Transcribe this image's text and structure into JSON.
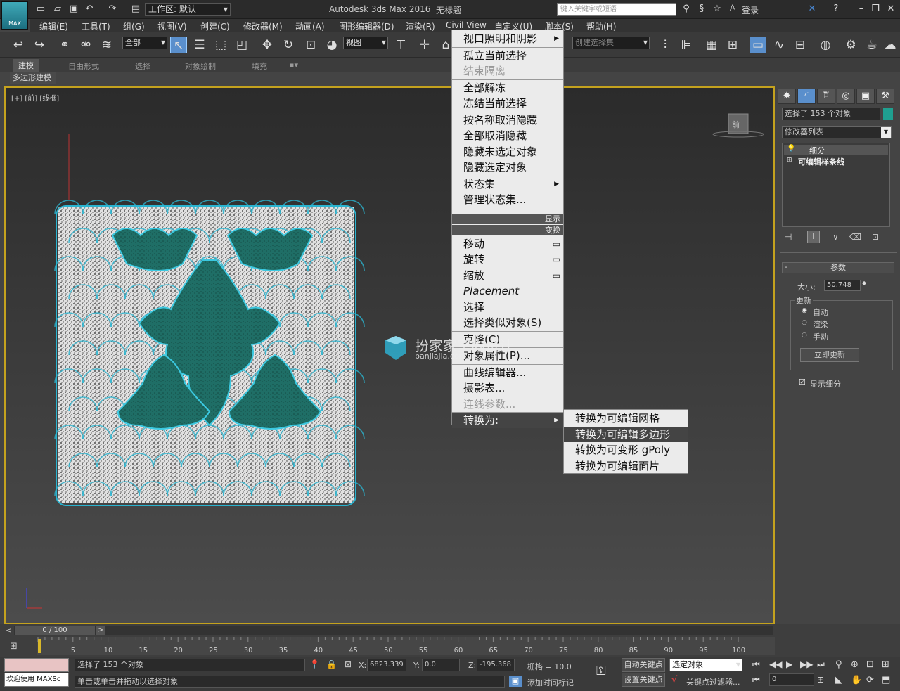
{
  "title": {
    "app": "Autodesk 3ds Max 2016",
    "doc": "无标题",
    "workspace": "工作区: 默认",
    "search_placeholder": "键入关键字或短语",
    "login": "登录",
    "max_logo": "MAX"
  },
  "menu": [
    "编辑(E)",
    "工具(T)",
    "组(G)",
    "视图(V)",
    "创建(C)",
    "修改器(M)",
    "动画(A)",
    "图形编辑器(D)",
    "渲染(R)",
    "Civil View",
    "自定义(U)",
    "脚本(S)",
    "帮助(H)"
  ],
  "toolbar": {
    "filter": "全部",
    "refcoord": "视图",
    "named_sel": "创建选择集"
  },
  "ribbon": {
    "tabs": [
      "建模",
      "自由形式",
      "选择",
      "对象绘制",
      "填充"
    ],
    "sub": "多边形建模"
  },
  "viewport": {
    "label": "[+] [前] [线框]",
    "viewcube": "前"
  },
  "context_menu": {
    "items_top": [
      "视口照明和阴影",
      "孤立当前选择",
      "结束隔离",
      "全部解冻",
      "冻结当前选择",
      "按名称取消隐藏",
      "全部取消隐藏",
      "隐藏未选定对象",
      "隐藏选定对象",
      "状态集",
      "管理状态集..."
    ],
    "hdr_display": "显示",
    "hdr_transform": "变换",
    "items_bottom": [
      "移动",
      "旋转",
      "缩放",
      "Placement",
      "选择",
      "选择类似对象(S)",
      "克隆(C)",
      "对象属性(P)...",
      "曲线编辑器...",
      "摄影表...",
      "连线参数...",
      "转换为:"
    ]
  },
  "submenu": [
    "转换为可编辑网格",
    "转换为可编辑多边形",
    "转换为可变形 gPoly",
    "转换为可编辑面片"
  ],
  "watermark": {
    "cn": "扮家家室内设计",
    "en": "banjiajia.com"
  },
  "panel": {
    "selected": "选择了 153 个对象",
    "modlist": "修改器列表",
    "stack": [
      "细分",
      "可编辑样条线"
    ],
    "rollout": "参数",
    "size_label": "大小:",
    "size_value": "50.748",
    "update_group": "更新",
    "radio": [
      "自动",
      "渲染",
      "手动"
    ],
    "update_btn": "立即更新",
    "show_sub": "显示细分"
  },
  "timeline": {
    "frame": "0 / 100",
    "ticks": [
      "5",
      "10",
      "15",
      "20",
      "25",
      "30",
      "35",
      "40",
      "45",
      "50",
      "55",
      "60",
      "65",
      "70",
      "75",
      "80",
      "85",
      "90",
      "95",
      "100"
    ]
  },
  "status": {
    "welcome": "欢迎使用 MAXSc",
    "selected": "选择了 153 个对象",
    "prompt": "单击或单击并拖动以选择对象",
    "x_label": "X:",
    "x": "6823.339",
    "y_label": "Y:",
    "y": "0.0",
    "z_label": "Z:",
    "z": "-195.368",
    "grid": "栅格 = 10.0",
    "add_time": "添加时间标记",
    "autokey": "自动关键点",
    "setkey": "设置关键点",
    "sel_obj": "选定对象",
    "key_filter": "关键点过滤器...",
    "frame_field": "0"
  }
}
